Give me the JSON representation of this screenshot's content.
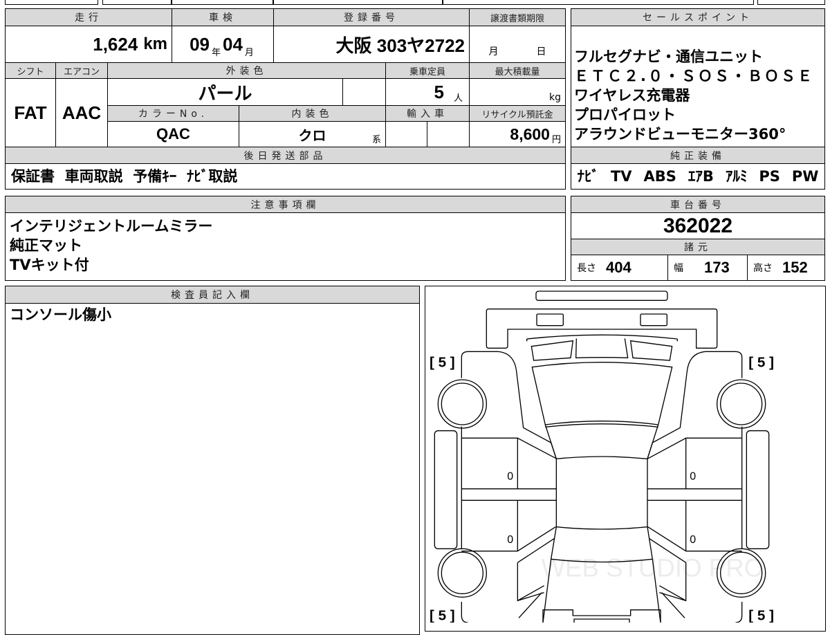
{
  "top": {
    "mileage_h": "走行",
    "mileage": "1,624",
    "mileage_unit": "km",
    "shaken_h": "車検",
    "shaken_year": "09",
    "year_unit": "年",
    "shaken_month": "04",
    "month_unit": "月",
    "reg_h": "登録番号",
    "reg": "大阪 303ヤ2722",
    "transfer_h": "譲渡書類期限",
    "transfer_month": "月",
    "transfer_day": "日",
    "shift_h": "シフト",
    "shift": "FAT",
    "ac_h": "エアコン",
    "ac": "AAC",
    "ext_color_h": "外装色",
    "ext_color": "パール",
    "capacity_h": "乗車定員",
    "capacity": "5",
    "capacity_unit": "人",
    "max_load_h": "最大積載量",
    "max_load_unit": "kg",
    "color_no_h": "カラーNo.",
    "color_no": "QAC",
    "int_color_h": "内装色",
    "int_color": "クロ",
    "int_color_unit": "系",
    "import_h": "輸入車",
    "recycle_h": "リサイクル預託金",
    "recycle": "8,600",
    "recycle_unit": "円",
    "later_parts_h": "後日発送部品",
    "later_parts": "保証書  車両取説  予備ｷｰ  ﾅﾋﾞ取説"
  },
  "sales": {
    "h": "セールスポイント",
    "lines": [
      "フルセグナビ・通信ユニット",
      "ＥＴＣ２.０・ＳＯＳ・ＢＯＳＥ",
      "ワイヤレス充電器",
      "プロパイロット",
      "アラウンドビューモニター360°"
    ]
  },
  "equipment": {
    "h": "純正装備",
    "items": [
      "ﾅﾋﾞ",
      "TV",
      "ABS",
      "ｴｱB",
      "ｱﾙﾐ",
      "PS",
      "PW"
    ]
  },
  "notes": {
    "h": "注意事項欄",
    "lines": [
      "インテリジェントルームミラー",
      "純正マット",
      "TVキット付"
    ]
  },
  "chassis": {
    "h": "車台番号",
    "value": "362022",
    "spec_h": "諸元",
    "length_label": "長さ",
    "length": "404",
    "width_label": "幅",
    "width": "173",
    "height_label": "高さ",
    "height": "152"
  },
  "inspector": {
    "h": "検査員記入欄",
    "text": "コンソール傷小"
  },
  "diagram": {
    "corner_scores": [
      "[ 5 ]",
      "[ 5 ]",
      "[ 5 ]",
      "[ 5 ]"
    ],
    "door_marks": [
      "0",
      "0",
      "0",
      "0"
    ],
    "watermark": "WEB STUDIO PRO"
  }
}
